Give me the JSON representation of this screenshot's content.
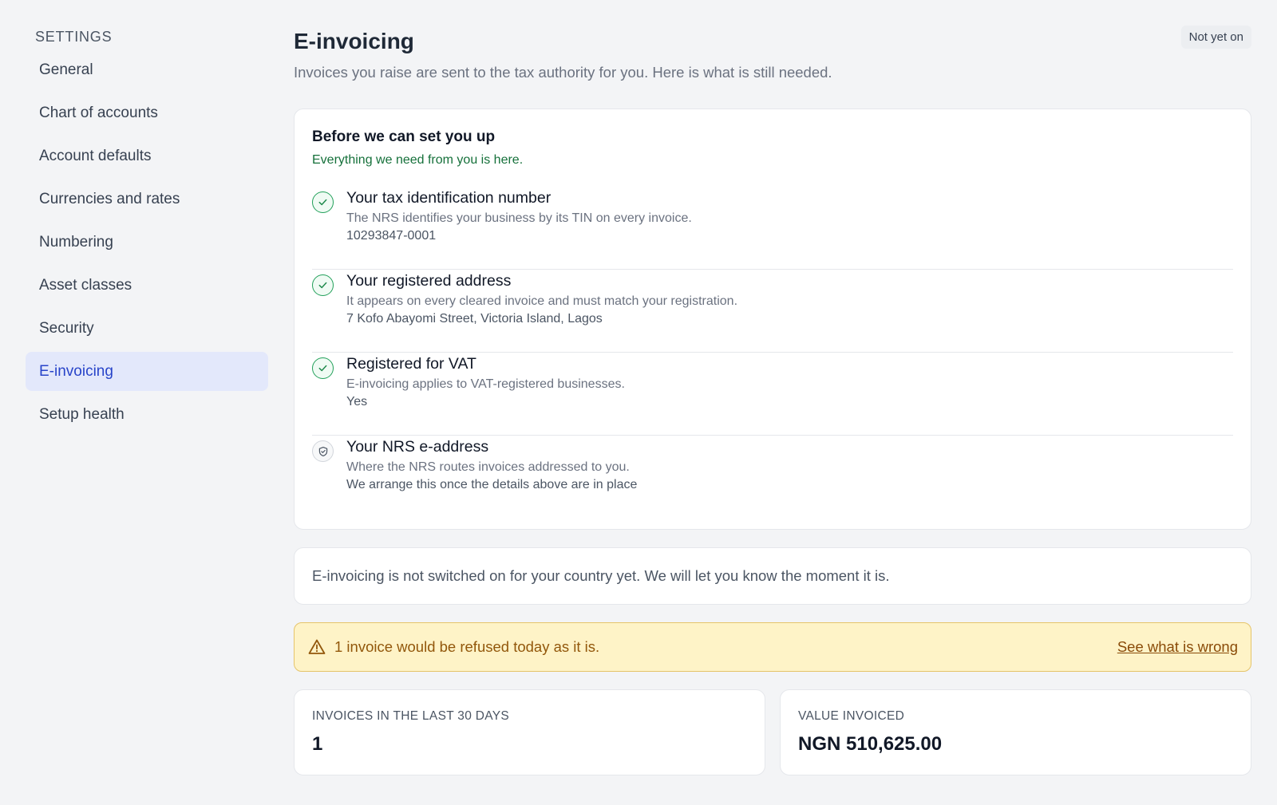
{
  "sidebar": {
    "heading": "SETTINGS",
    "items": [
      {
        "label": "General"
      },
      {
        "label": "Chart of accounts"
      },
      {
        "label": "Account defaults"
      },
      {
        "label": "Currencies and rates"
      },
      {
        "label": "Numbering"
      },
      {
        "label": "Asset classes"
      },
      {
        "label": "Security"
      },
      {
        "label": "E-invoicing",
        "active": true
      },
      {
        "label": "Setup health"
      }
    ]
  },
  "header": {
    "title": "E-invoicing",
    "subtitle": "Invoices you raise are sent to the tax authority for you. Here is what is still needed.",
    "status": "Not yet on"
  },
  "setup": {
    "title": "Before we can set you up",
    "note": "Everything we need from you is here.",
    "items": [
      {
        "icon": "check-icon",
        "title": "Your tax identification number",
        "description": "The NRS identifies your business by its TIN on every invoice.",
        "value": "10293847-0001"
      },
      {
        "icon": "check-icon",
        "title": "Your registered address",
        "description": "It appears on every cleared invoice and must match your registration.",
        "value": "7 Kofo Abayomi Street, Victoria Island, Lagos"
      },
      {
        "icon": "check-icon",
        "title": "Registered for VAT",
        "description": "E-invoicing applies to VAT-registered businesses.",
        "value": "Yes"
      },
      {
        "icon": "shield-icon",
        "title": "Your NRS e-address",
        "description": "Where the NRS routes invoices addressed to you.",
        "value": "We arrange this once the details above are in place"
      }
    ]
  },
  "notice": {
    "text": "E-invoicing is not switched on for your country yet. We will let you know the moment it is."
  },
  "warning": {
    "icon": "warning-triangle-icon",
    "text": "1 invoice would be refused today as it is.",
    "link": "See what is wrong"
  },
  "stats": [
    {
      "label": "INVOICES IN THE LAST 30 DAYS",
      "value": "1"
    },
    {
      "label": "VALUE INVOICED",
      "value": "NGN 510,625.00"
    }
  ],
  "colors": {
    "accent": "#2844c9",
    "success": "#22a05a",
    "warning_bg": "#fef3c7",
    "warning_text": "#92570b"
  }
}
